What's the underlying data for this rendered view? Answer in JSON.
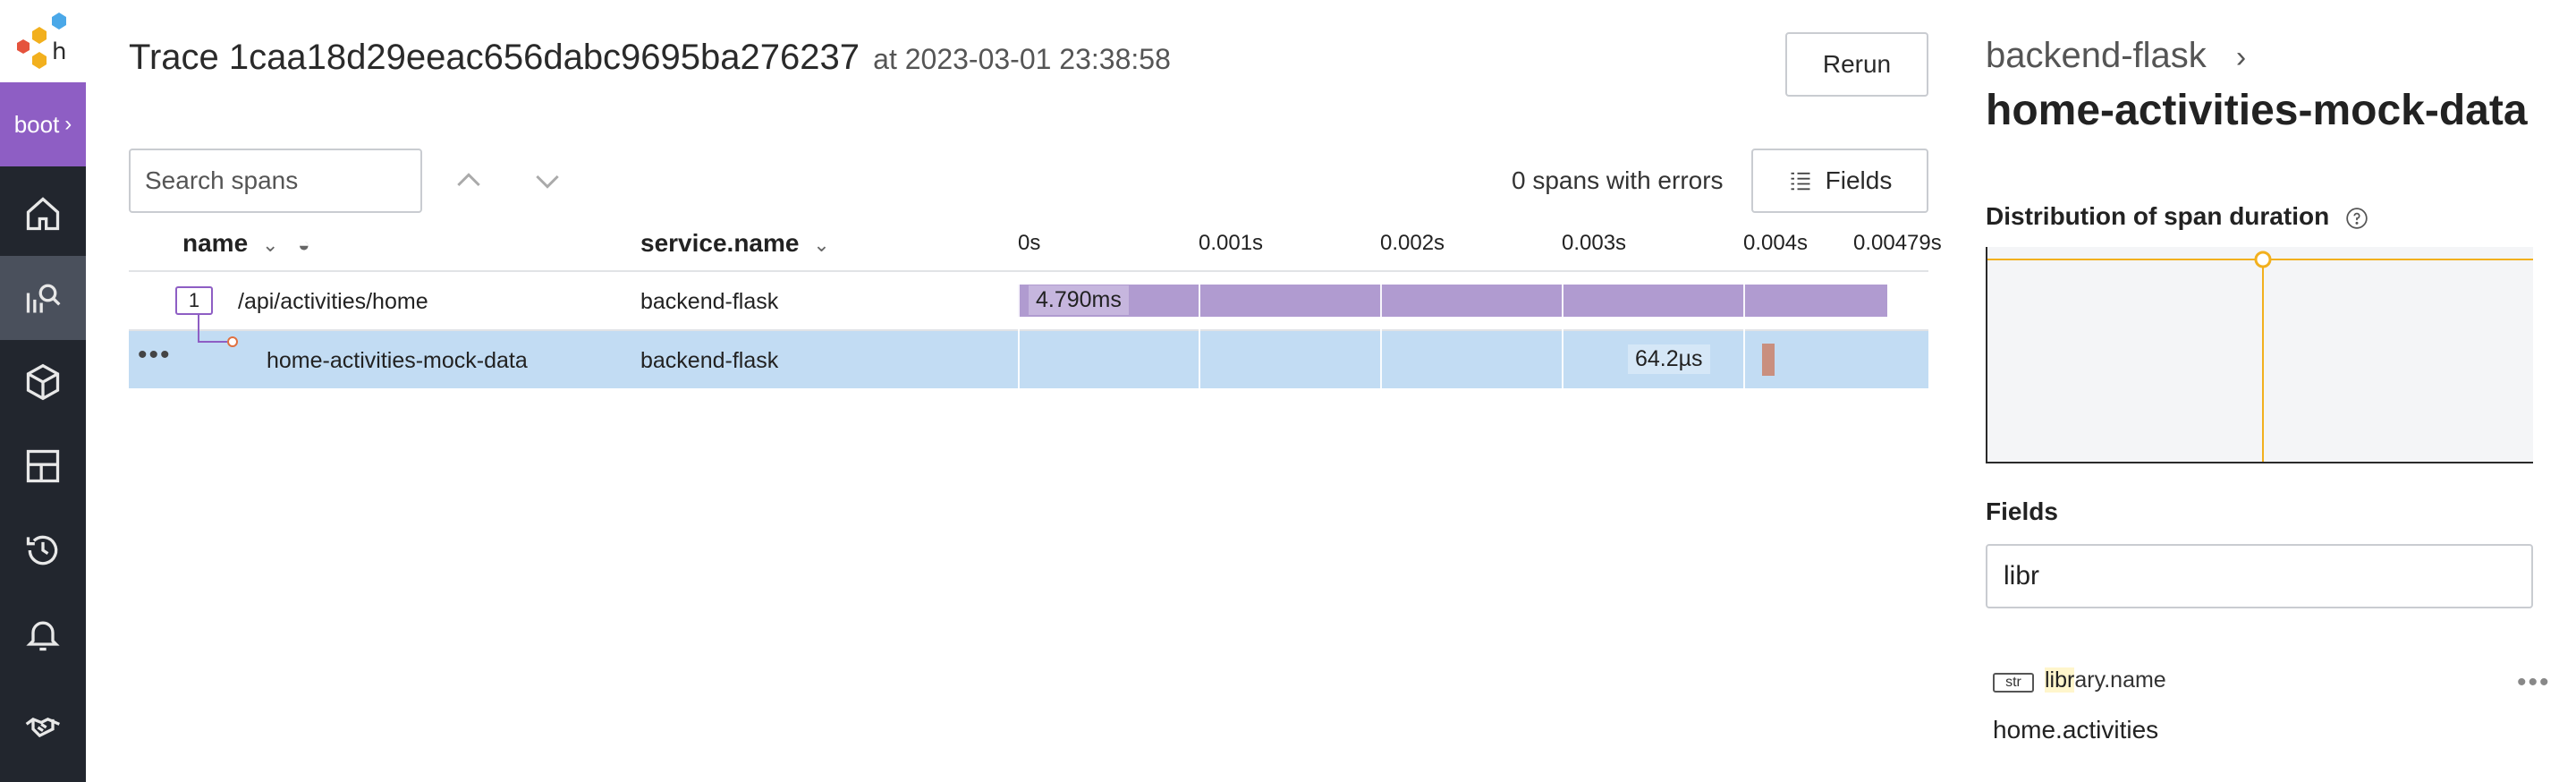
{
  "nav": {
    "environment": "boot",
    "items": [
      {
        "icon": "home-icon"
      },
      {
        "icon": "query-icon",
        "active": true
      },
      {
        "icon": "dataset-cube-icon"
      },
      {
        "icon": "boards-grid-icon"
      },
      {
        "icon": "history-icon"
      },
      {
        "icon": "triggers-bell-icon"
      },
      {
        "icon": "support-handshake-icon"
      }
    ]
  },
  "trace": {
    "title": "Trace 1caa18d29eeac656dabc9695ba276237",
    "timestamp": "at 2023-03-01 23:38:58",
    "rerun_label": "Rerun",
    "search_placeholder": "Search spans",
    "errors_text": "0 spans with errors",
    "fields_label": "Fields",
    "columns": {
      "name": "name",
      "service": "service.name"
    },
    "ticks": [
      "0s",
      "0.001s",
      "0.002s",
      "0.003s",
      "0.004s",
      "0.00479s"
    ],
    "spans": [
      {
        "children_count": "1",
        "name": "/api/activities/home",
        "service": "backend-flask",
        "duration": "4.790ms",
        "start": 0,
        "length": 4.79
      },
      {
        "name": "home-activities-mock-data",
        "service": "backend-flask",
        "duration": "64.2µs",
        "start": 4.1,
        "length": 0.0642,
        "selected": true
      }
    ]
  },
  "detail": {
    "service": "backend-flask",
    "span_name": "home-activities-mock-data",
    "distribution_label": "Distribution of span duration",
    "fields_label": "Fields",
    "filter_value": "libr",
    "field": {
      "type": "str",
      "name_match": "libr",
      "name_rest": "ary.name",
      "value": "home.activities"
    }
  },
  "colors": {
    "accent": "#8e5ec4",
    "bar": "#b09bd0",
    "selected_row": "#c2dcf3",
    "chart_line": "#f2b01e"
  }
}
